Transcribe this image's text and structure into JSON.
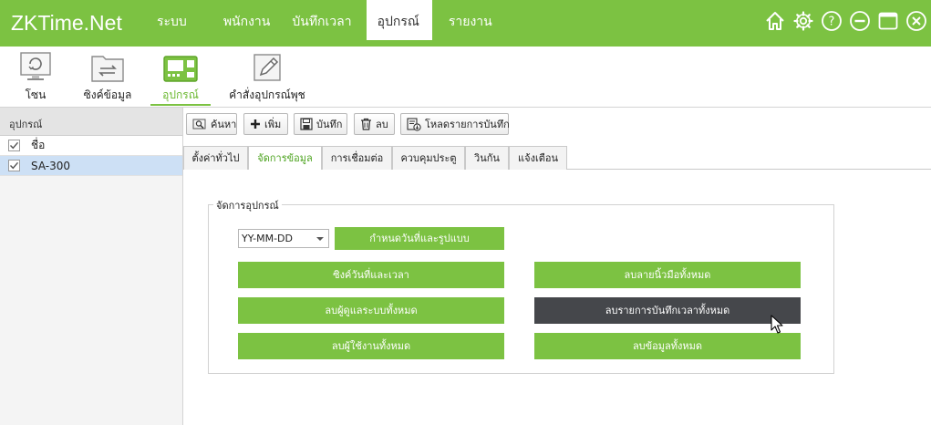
{
  "app": {
    "logo_main": "ZKTime",
    "logo_suffix": ".Net"
  },
  "nav": [
    {
      "label": "ระบบ"
    },
    {
      "label": "พนักงาน"
    },
    {
      "label": "บันทึกเวลา"
    },
    {
      "label": "อุปกรณ์",
      "active": true
    },
    {
      "label": "รายงาน"
    }
  ],
  "window_controls": [
    "home-icon",
    "gear-icon",
    "help-icon",
    "minimize-icon",
    "maximize-icon",
    "close-icon"
  ],
  "ribbon": [
    {
      "label": "โซน",
      "icon": "zone-monitor-icon"
    },
    {
      "label": "ซิงค์ข้อมูล",
      "icon": "sync-folder-icon"
    },
    {
      "label": "อุปกรณ์",
      "icon": "device-terminal-icon",
      "active": true
    },
    {
      "label": "คำสั่งอุปกรณ์พุช",
      "icon": "push-command-icon"
    }
  ],
  "left_panel": {
    "header": "อุปกรณ์",
    "column_header": "ชื่อ",
    "devices": [
      {
        "name": "SA-300",
        "checked": true,
        "selected": true
      }
    ]
  },
  "toolbar": {
    "search": "ค้นหา",
    "add": "เพิ่ม",
    "save": "บันทึก",
    "delete": "ลบ",
    "download_logs": "โหลดรายการบันทึก"
  },
  "tabs": [
    {
      "label": "ตั้งค่าทั่วไป"
    },
    {
      "label": "จัดการข้อมูล",
      "active": true
    },
    {
      "label": "การเชื่อมต่อ"
    },
    {
      "label": "ควบคุมประตู"
    },
    {
      "label": "วินกัน"
    },
    {
      "label": "แจ้งเตือน"
    }
  ],
  "group": {
    "title": "จัดการอุปกรณ์",
    "date_format_value": "YY-MM-DD",
    "set_date_format": "กำหนดวันที่และรูปแบบ",
    "sync_datetime": "ซิงค์วันที่และเวลา",
    "delete_admins": "ลบผู้ดูแลระบบทั้งหมด",
    "delete_users": "ลบผู้ใช้งานทั้งหมด",
    "delete_fingerprints": "ลบลายนิ้วมือทั้งหมด",
    "delete_attendance_logs": "ลบรายการบันทึกเวลาทั้งหมด",
    "delete_all_data": "ลบข้อมูลทั้งหมด"
  },
  "colors": {
    "brand_green": "#7cc242",
    "hover_dark": "#45474b",
    "selection_blue": "#cde0f5"
  }
}
